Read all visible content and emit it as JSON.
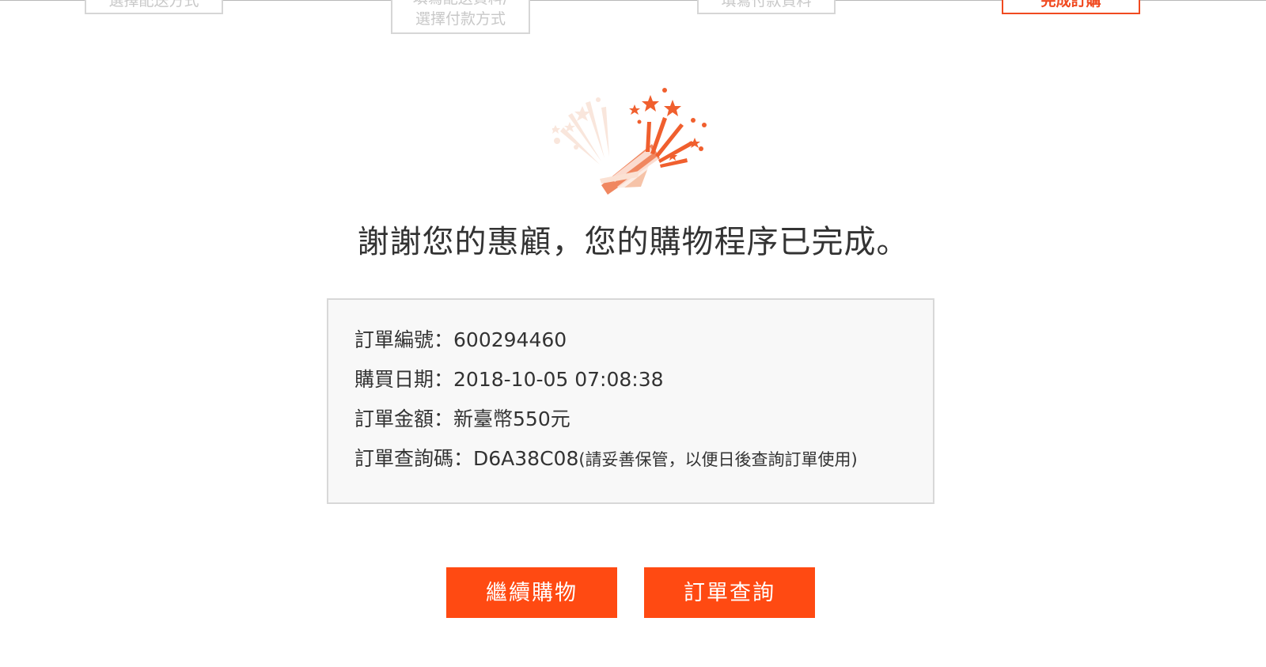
{
  "steps": [
    {
      "lines": [
        "選擇配送方式"
      ]
    },
    {
      "lines": [
        "填寫配送資料/",
        "選擇付款方式"
      ]
    },
    {
      "lines": [
        "填寫付款資料"
      ]
    },
    {
      "lines": [
        "完成訂購"
      ]
    }
  ],
  "thanks_message": "謝謝您的惠顧，您的購物程序已完成。",
  "order": {
    "number_label": "訂單編號：",
    "number": "600294460",
    "date_label": "購買日期：",
    "date": "2018-10-05 07:08:38",
    "amount_label": "訂單金額：",
    "amount": "新臺幣550元",
    "query_code_label": "訂單查詢碼：",
    "query_code": "D6A38C08",
    "query_code_note": "(請妥善保管，以便日後查詢訂單使用)"
  },
  "buttons": {
    "continue_shopping": "繼續購物",
    "order_query": "訂單查詢"
  },
  "colors": {
    "accent": "#ff4a12",
    "active_step": "#f04a20"
  },
  "icons": {
    "celebration": "party-popper-icon"
  }
}
